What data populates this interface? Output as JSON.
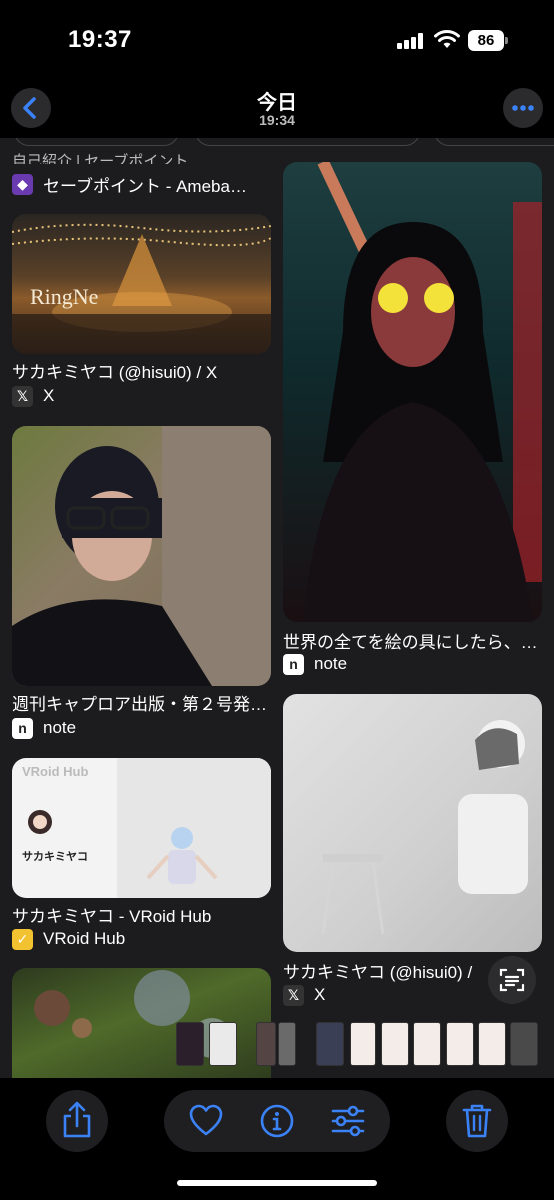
{
  "status_bar": {
    "time": "19:37",
    "battery": "86"
  },
  "navbar": {
    "title": "今日",
    "subtitle": "19:34"
  },
  "cards": {
    "clipped_text": "自己紹介 | セーブポイント",
    "card1": {
      "source_label": "セーブポイント - Ameba…",
      "image_text": "RingNe"
    },
    "card2": {
      "title": "サカキミヤコ (@hisui0) / X",
      "source_label": "X"
    },
    "card3": {
      "title": "週刊キャプロア出版・第２号発…",
      "source_label": "note"
    },
    "card4": {
      "title": "サカキミヤコ - VRoid Hub",
      "source_label": "VRoid Hub",
      "image_header": "VRoid Hub",
      "image_name": "サカキミヤコ"
    },
    "right1": {
      "title": "世界の全てを絵の具にしたら、…",
      "source_label": "note"
    },
    "right2": {
      "title": "サカキミヤコ (@hisui0) /",
      "source_label": "X"
    }
  },
  "icons": {
    "back": "chevron-left-icon",
    "more": "ellipsis-icon",
    "share": "share-icon",
    "favorite": "heart-icon",
    "info": "info-icon",
    "adjust": "sliders-icon",
    "delete": "trash-icon",
    "live_text": "text-scan-icon"
  },
  "colors": {
    "accent": "#3b82f6",
    "background": "#1c1c1e",
    "bar": "#000000"
  }
}
